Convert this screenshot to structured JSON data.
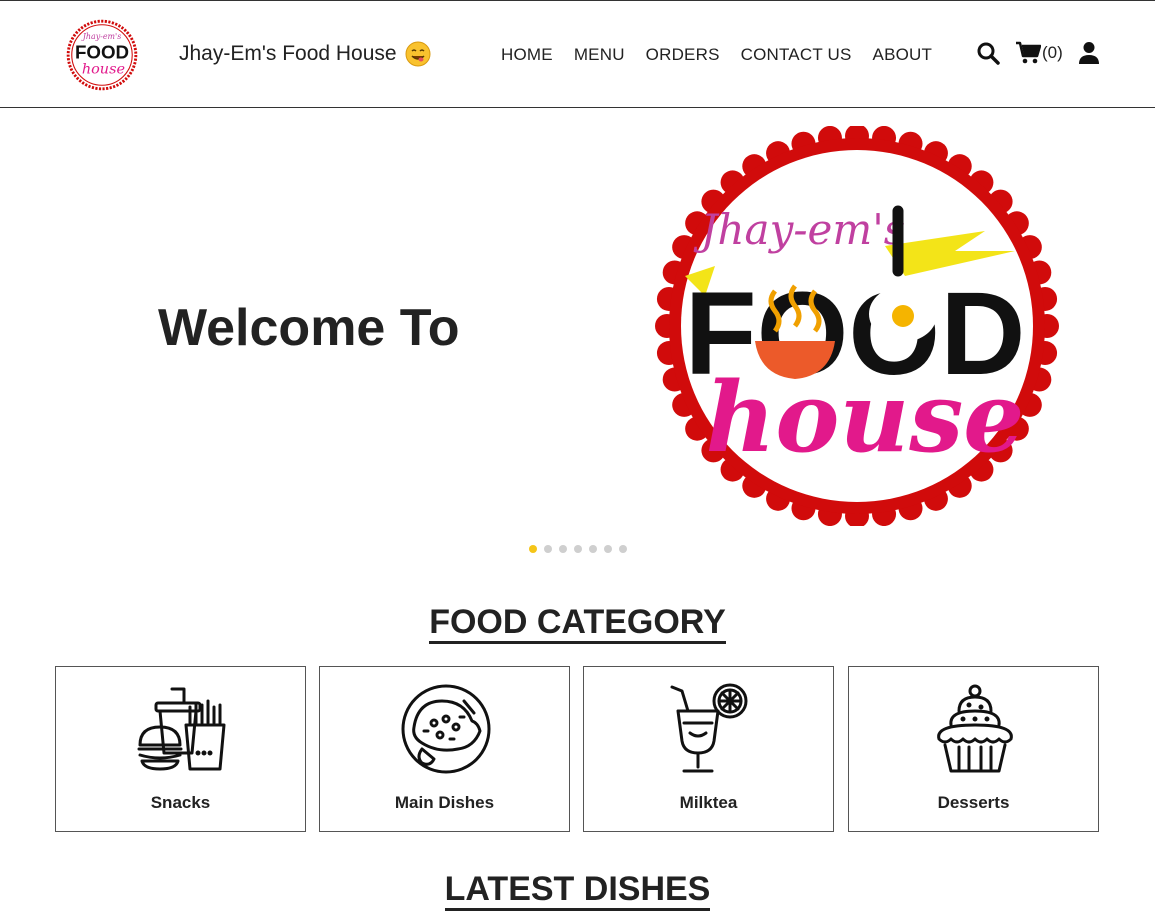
{
  "brand": {
    "name": "Jhay-Em's Food House"
  },
  "nav": {
    "items": [
      "HOME",
      "MENU",
      "ORDERS",
      "CONTACT US",
      "ABOUT"
    ]
  },
  "cart": {
    "count": "(0)"
  },
  "hero": {
    "welcome": "Welcome To",
    "logo_script": "Jhay-em's",
    "logo_word1": "FOOD",
    "logo_word2": "house"
  },
  "carousel": {
    "slides": 7,
    "active": 1
  },
  "sections": {
    "food_category": "FOOD CATEGORY",
    "latest_dishes": "LATEST DISHES"
  },
  "categories": [
    {
      "label": "Snacks",
      "icon": "snacks-icon"
    },
    {
      "label": "Main Dishes",
      "icon": "main-dishes-icon"
    },
    {
      "label": "Milktea",
      "icon": "milktea-icon"
    },
    {
      "label": "Desserts",
      "icon": "dessert-icon"
    }
  ],
  "colors": {
    "logo_red": "#d10b0b",
    "logo_pink": "#e2198b",
    "accent_yellow": "#f5c518",
    "text": "#222222"
  }
}
